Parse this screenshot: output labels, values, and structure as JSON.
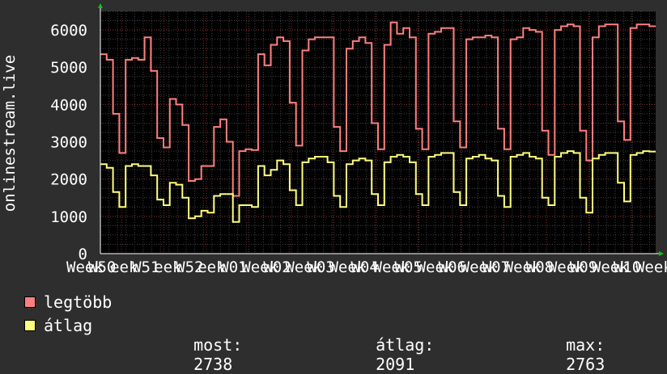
{
  "colors": {
    "background": "#2e2e2e",
    "plot_background": "#000000",
    "grid_major": "#8a2a2a",
    "grid_minor": "#444444",
    "axis": "#ffffff",
    "text": "#ffffff",
    "series_max": "#ff7f7f",
    "series_avg": "#ffff7f"
  },
  "legend": {
    "max_label": "legtöbb",
    "avg_label": "átlag",
    "now_label": "most:",
    "now_value": "2738",
    "avg_stat_label": "átlag:",
    "avg_stat_value": "2091",
    "max_stat_label": "max:",
    "max_stat_value": "2763"
  },
  "chart_data": {
    "type": "line",
    "ylabel": "onlinestream.live",
    "ylim": [
      0,
      6500
    ],
    "yticks": [
      0,
      1000,
      2000,
      3000,
      4000,
      5000,
      6000
    ],
    "categories": [
      "Week 50",
      "Week 51",
      "Week 52",
      "Week 01",
      "Week 02",
      "Week 03",
      "Week 04",
      "Week 05",
      "Week 06",
      "Week 07",
      "Week 08",
      "Week 09",
      "Week 10"
    ],
    "xtick_labels": [
      "Week",
      "W50",
      "eek",
      "W51",
      "eek",
      "W52",
      "eek",
      "W01",
      "Week",
      "W02",
      "Week",
      "W03",
      "Week",
      "W04",
      "Week",
      "W05",
      "Week",
      "W06",
      "Week",
      "W07",
      "Week",
      "W08",
      "Week",
      "W09",
      "Week",
      "W10",
      "Week"
    ],
    "grid": true,
    "series": [
      {
        "name": "legtöbb",
        "color": "#ff7f7f",
        "values": [
          5350,
          5200,
          3750,
          2700,
          5200,
          5250,
          5200,
          5800,
          4900,
          3100,
          2850,
          4150,
          4000,
          3450,
          1950,
          2000,
          2350,
          2350,
          3400,
          3600,
          3000,
          1550,
          2750,
          2800,
          2780,
          5350,
          5050,
          5600,
          5800,
          5700,
          4050,
          2900,
          5450,
          5750,
          5800,
          5800,
          5800,
          3400,
          2750,
          5500,
          5700,
          5800,
          5650,
          3500,
          2800,
          5600,
          6200,
          5900,
          6050,
          5800,
          3350,
          2800,
          5900,
          5950,
          6050,
          6050,
          3550,
          2850,
          5750,
          5800,
          5800,
          5850,
          5800,
          3350,
          2800,
          5750,
          5800,
          6050,
          6000,
          5950,
          3300,
          2650,
          6000,
          6100,
          6150,
          6100,
          3300,
          2500,
          5800,
          6100,
          6150,
          6150,
          3550,
          3050,
          6050,
          6150,
          6150,
          6100
        ]
      },
      {
        "name": "átlag",
        "color": "#ffff7f",
        "values": [
          2400,
          2300,
          1650,
          1250,
          2350,
          2400,
          2350,
          2350,
          2100,
          1450,
          1300,
          1900,
          1850,
          1500,
          950,
          1000,
          1150,
          1100,
          1550,
          1600,
          1600,
          850,
          1300,
          1300,
          1250,
          2350,
          2100,
          2250,
          2500,
          2400,
          1700,
          1300,
          2450,
          2550,
          2600,
          2600,
          2450,
          1550,
          1250,
          2400,
          2500,
          2550,
          2500,
          1600,
          1300,
          2450,
          2600,
          2650,
          2600,
          2450,
          1600,
          1300,
          2600,
          2650,
          2700,
          2700,
          1650,
          1300,
          2550,
          2600,
          2650,
          2550,
          2500,
          1550,
          1250,
          2600,
          2650,
          2700,
          2600,
          2550,
          1500,
          1300,
          2600,
          2700,
          2750,
          2700,
          1500,
          1100,
          2550,
          2650,
          2700,
          2700,
          1900,
          1400,
          2650,
          2700,
          2750,
          2738
        ]
      }
    ]
  }
}
